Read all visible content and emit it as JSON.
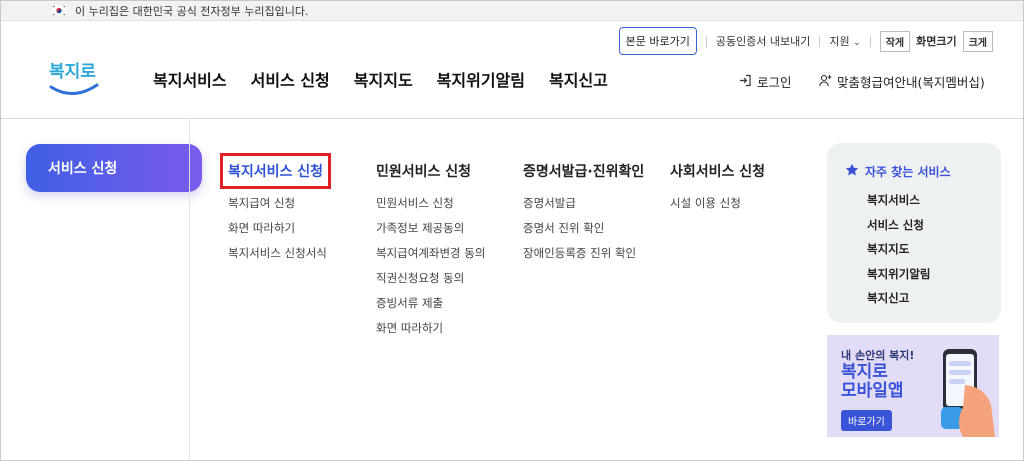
{
  "gov_banner": {
    "text": "이 누리집은 대한민국 공식 전자정부 누리집입니다."
  },
  "utility": {
    "skip_label": "본문 바로가기",
    "cert_label": "공동인증서 내보내기",
    "support_label": "지원",
    "small_label": "작게",
    "font_size_label": "화면크기",
    "large_label": "크게"
  },
  "logo": {
    "text": "복지로"
  },
  "gnb": {
    "items": [
      "복지서비스",
      "서비스 신청",
      "복지지도",
      "복지위기알림",
      "복지신고"
    ]
  },
  "header_actions": {
    "login": "로그인",
    "guide": "맞춤형급여안내(복지멤버십)"
  },
  "side": {
    "active_label": "서비스 신청"
  },
  "menu": {
    "columns": [
      {
        "head": "복지서비스 신청",
        "items": [
          "복지급여 신청",
          "화면 따라하기",
          "복지서비스 신청서식"
        ]
      },
      {
        "head": "민원서비스 신청",
        "items": [
          "민원서비스 신청",
          "가족정보 제공동의",
          "복지급여계좌변경 동의",
          "직권신청요청 동의",
          "증빙서류 제출",
          "화면 따라하기"
        ]
      },
      {
        "head": "증명서발급·진위확인",
        "items": [
          "증명서발급",
          "증명서 진위 확인",
          "장애인등록증 진위 확인"
        ]
      },
      {
        "head": "사회서비스 신청",
        "items": [
          "시설 이용 신청"
        ]
      }
    ]
  },
  "favorites": {
    "title": "자주 찾는 서비스",
    "items": [
      "복지서비스",
      "서비스 신청",
      "복지지도",
      "복지위기알림",
      "복지신고"
    ]
  },
  "banner": {
    "line1": "내 손안의 복지!",
    "line2a": "복지로",
    "line2b": "모바일앱",
    "button": "바로가기"
  },
  "colors": {
    "accent": "#3b52d8",
    "highlight": "#e01f26",
    "gradient_start": "#3f5fe6",
    "gradient_end": "#7b5bea"
  }
}
